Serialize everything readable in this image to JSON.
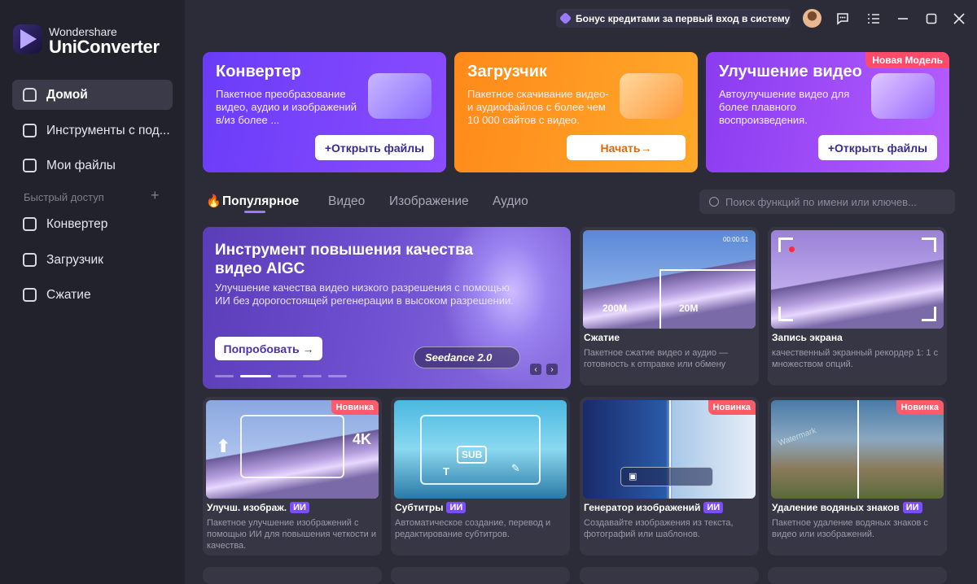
{
  "app": {
    "brand_top": "Wondershare",
    "brand_name": "UniConverter"
  },
  "titlebar": {
    "bonus": "Бонус кредитами за первый вход в систему",
    "icons": [
      "avatar",
      "chat-icon",
      "menu-icon",
      "minimize-icon",
      "maximize-icon",
      "close-icon"
    ]
  },
  "sidebar": {
    "items": [
      {
        "label": "Домой",
        "icon": "home-icon",
        "active": true
      },
      {
        "label": "Инструменты с под...",
        "icon": "toolbox-icon"
      },
      {
        "label": "Мои файлы",
        "icon": "file-icon"
      }
    ],
    "quick_access_label": "Быстрый доступ",
    "quick_items": [
      {
        "label": "Конвертер",
        "icon": "converter-icon"
      },
      {
        "label": "Загрузчик",
        "icon": "download-icon"
      },
      {
        "label": "Сжатие",
        "icon": "compress-icon"
      }
    ]
  },
  "cards": [
    {
      "title": "Конвертер",
      "desc": "Пакетное преобразование видео, аудио и изображений в/из более ...",
      "button": "+Открыть файлы",
      "color": "#7a3cff"
    },
    {
      "title": "Загрузчик",
      "desc": "Пакетное скачивание видео- и аудиофайлов с более чем 10 000 сайтов с видео.",
      "button": "Начать→",
      "color": "#ff8a1a"
    },
    {
      "title": "Улучшение видео",
      "desc": "Автоулучшение видео для более плавного воспроизведения.",
      "button": "+Открыть файлы",
      "badge": "Новая Модель",
      "color": "#9a3cf0"
    }
  ],
  "tabs": [
    "Популярное",
    "Видео",
    "Изображение",
    "Аудио"
  ],
  "search": {
    "placeholder": "Поиск функций по имени или ключев..."
  },
  "banner": {
    "title": "Инструмент повышения качества видео AIGC",
    "desc": "Улучшение качества видео низкого разрешения с помощью ИИ без дорогостоящей регенерации в высоком разрешении.",
    "button": "Попробовать →",
    "logo_text": "Seedance 2.0"
  },
  "tiles": [
    {
      "title": "Сжатие",
      "desc": "Пакетное сжатие видео и аудио — готовность к отправке или обмену",
      "from": "200M",
      "to": "20M",
      "time": "00:00:51"
    },
    {
      "title": "Запись экрана",
      "desc": "качественный экранный рекордер 1: 1 с множеством опций."
    },
    {
      "title": "Улучш. изображ.",
      "ai": "ИИ",
      "badge": "Новинка",
      "desc": "Пакетное улучшение изображений с помощью ИИ для повышения четкости и качества.",
      "label": "4K"
    },
    {
      "title": "Субтитры",
      "ai": "ИИ",
      "desc": "Автоматическое создание, перевод и редактирование субтитров.",
      "label": "SUB",
      "text_mark": "T"
    },
    {
      "title": "Генератор изображений",
      "ai": "ИИ",
      "badge": "Новинка",
      "desc": "Создавайте изображения из текста, фотографий или шаблонов."
    },
    {
      "title": "Удаление водяных знаков",
      "ai": "ИИ",
      "badge": "Новинка",
      "desc": "Пакетное удаление водяных знаков с видео или изображений.",
      "watermark": "Watermark"
    }
  ]
}
